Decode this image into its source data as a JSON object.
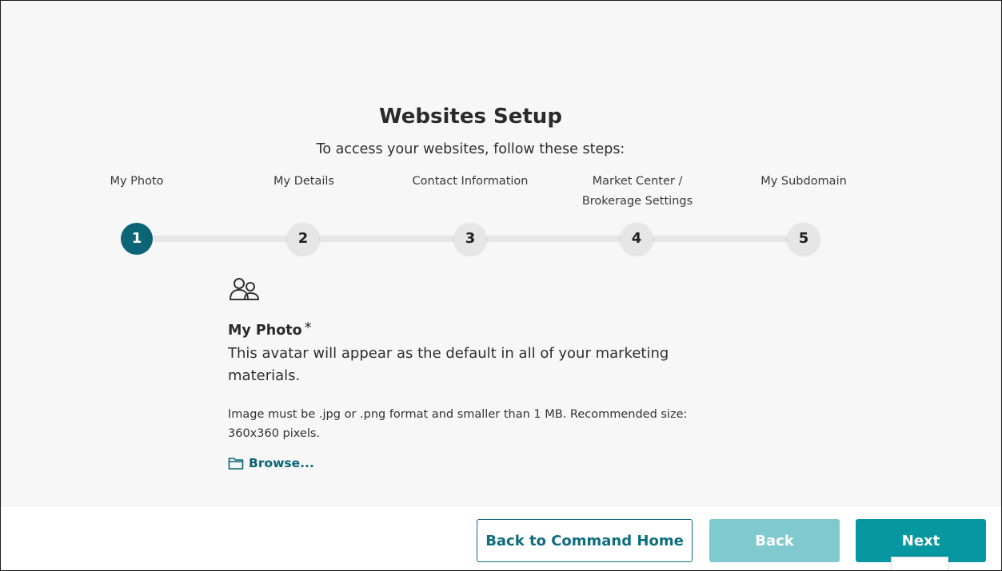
{
  "page": {
    "title": "Websites Setup",
    "subtitle": "To access your websites, follow these steps:"
  },
  "stepper": {
    "active_step": 1,
    "steps": [
      {
        "number": "1",
        "label_line1": "",
        "label_line2": "My Photo",
        "active": true
      },
      {
        "number": "2",
        "label_line1": "",
        "label_line2": "My Details",
        "active": false
      },
      {
        "number": "3",
        "label_line1": "",
        "label_line2": "Contact Information",
        "active": false
      },
      {
        "number": "4",
        "label_line1": "Market Center /",
        "label_line2": "Brokerage Settings",
        "active": false
      },
      {
        "number": "5",
        "label_line1": "",
        "label_line2": "My Subdomain",
        "active": false
      }
    ]
  },
  "photo_section": {
    "icon": "users-icon",
    "title": "My Photo",
    "required_mark": "*",
    "description": "This avatar will appear as the default in all of your marketing materials.",
    "note": "Image must be .jpg or .png format and smaller than 1 MB. Recommended size: 360x360 pixels.",
    "browse_icon": "folder-icon",
    "browse_label": "Browse..."
  },
  "footer": {
    "back_home_label": "Back to Command Home",
    "back_label": "Back",
    "next_label": "Next"
  },
  "colors": {
    "accent": "#0b6577",
    "primary_button": "#0797a1",
    "disabled_button": "#7fc9cf",
    "step_inactive": "#e6e6e6"
  }
}
